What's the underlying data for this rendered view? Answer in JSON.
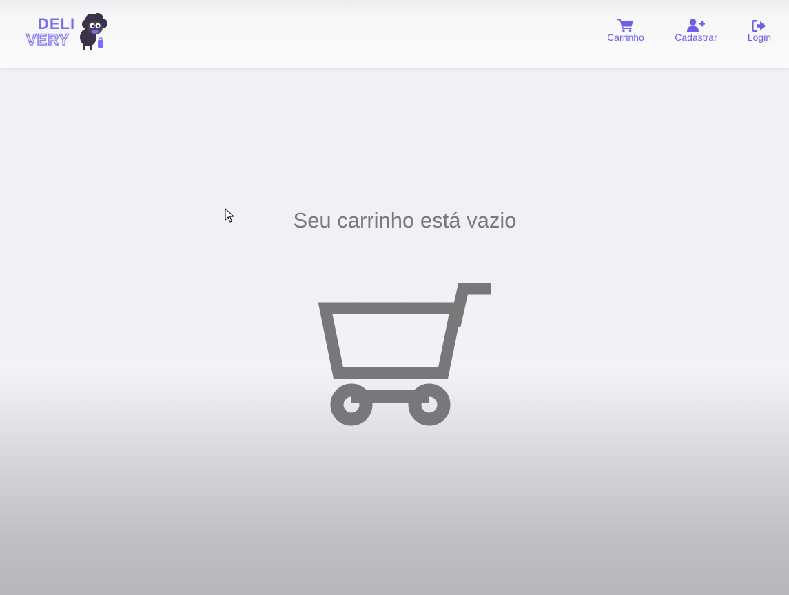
{
  "header": {
    "logo": {
      "line1": "DELI",
      "line2": "VERY",
      "mascot_icon": "sheep-mascot-icon"
    },
    "nav": [
      {
        "label": "Carrinho",
        "icon": "cart-icon"
      },
      {
        "label": "Cadastrar",
        "icon": "user-plus-icon"
      },
      {
        "label": "Login",
        "icon": "sign-in-icon"
      }
    ]
  },
  "main": {
    "empty_message": "Seu carrinho está vazio",
    "illustration_icon": "empty-cart-icon"
  },
  "colors": {
    "accent": "#6d5fe6",
    "muted_text": "#7a797c",
    "cart_gray": "#787779"
  }
}
